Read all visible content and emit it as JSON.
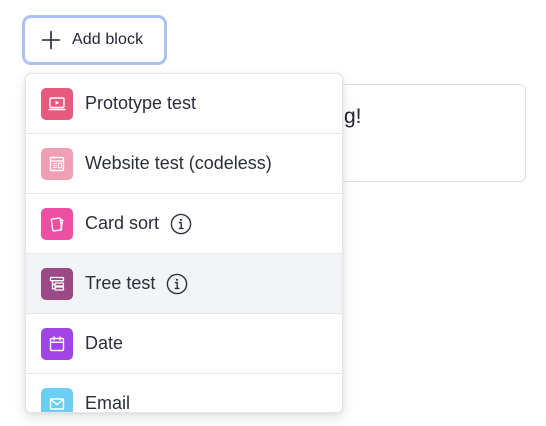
{
  "toolbar": {
    "add_block_label": "Add block"
  },
  "background_card": {
    "text": "g!"
  },
  "menu": {
    "items": [
      {
        "label": "Prototype test",
        "icon": "prototype-icon",
        "color": "#e65a7d",
        "info": false
      },
      {
        "label": "Website test (codeless)",
        "icon": "website-icon",
        "color": "#ef9fb4",
        "info": false
      },
      {
        "label": "Card sort",
        "icon": "cards-icon",
        "color": "#ec4fa1",
        "info": true
      },
      {
        "label": "Tree test",
        "icon": "tree-icon",
        "color": "#9b4987",
        "info": true,
        "highlighted": true
      },
      {
        "label": "Date",
        "icon": "calendar-icon",
        "color": "#a044e6",
        "info": false
      },
      {
        "label": "Email",
        "icon": "mail-icon",
        "color": "#6dcdf3",
        "info": false
      }
    ]
  },
  "colors": {
    "focus_ring": "#a9c2f3",
    "highlight_row": "#f3f4f6",
    "text": "#2a2e3a"
  }
}
